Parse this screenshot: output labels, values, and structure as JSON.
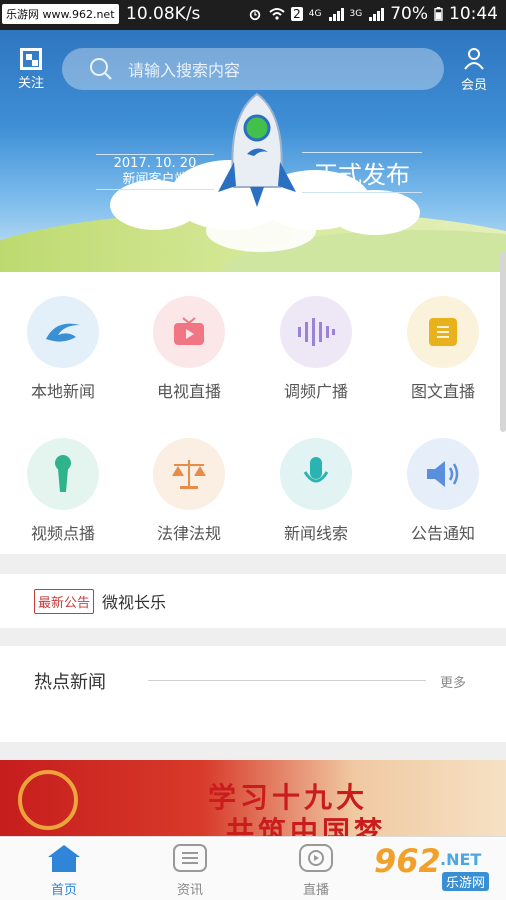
{
  "status_bar": {
    "watermark": "乐游网 www.962.net",
    "speed": "10.08K/s",
    "network_4g": "4G",
    "network_3g": "3G",
    "sim_badge": "2",
    "battery": "70%",
    "time": "10:44"
  },
  "header": {
    "follow_label": "关注",
    "search_placeholder": "请输入搜索内容",
    "member_label": "会员"
  },
  "banner": {
    "date": "2017. 10. 20",
    "subtitle": "新闻客户端",
    "title": "正式发布"
  },
  "features": [
    {
      "label": "本地新闻",
      "icon": "local-news-icon",
      "bg": "#e4f0f9",
      "fg": "#3b8fd3"
    },
    {
      "label": "电视直播",
      "icon": "tv-icon",
      "bg": "#fbe6e8",
      "fg": "#f07684"
    },
    {
      "label": "调频广播",
      "icon": "radio-wave-icon",
      "bg": "#eee8f6",
      "fg": "#9a82d6"
    },
    {
      "label": "图文直播",
      "icon": "document-icon",
      "bg": "#fbf2dc",
      "fg": "#e7b21b"
    },
    {
      "label": "视频点播",
      "icon": "microphone-handheld-icon",
      "bg": "#e4f5ef",
      "fg": "#2fb38a"
    },
    {
      "label": "法律法规",
      "icon": "scale-icon",
      "bg": "#fbeee2",
      "fg": "#e78d4a"
    },
    {
      "label": "新闻线索",
      "icon": "microphone-icon",
      "bg": "#e1f3f3",
      "fg": "#2bb2b2"
    },
    {
      "label": "公告通知",
      "icon": "speaker-icon",
      "bg": "#e6eef9",
      "fg": "#5b8fdd"
    }
  ],
  "notice": {
    "tag": "最新公告",
    "text": "微视长乐"
  },
  "hot_news": {
    "title": "热点新闻",
    "more": "更多"
  },
  "promo": {
    "line1": "学习十九大",
    "line2": "共筑中国梦"
  },
  "nav": {
    "home": "首页",
    "info": "资讯",
    "live": "直播"
  },
  "watermark": {
    "num": "962",
    "net": ".NET",
    "cn": "乐游网"
  },
  "colors": {
    "accent": "#2f86d8",
    "notice_red": "#c93a3a"
  }
}
